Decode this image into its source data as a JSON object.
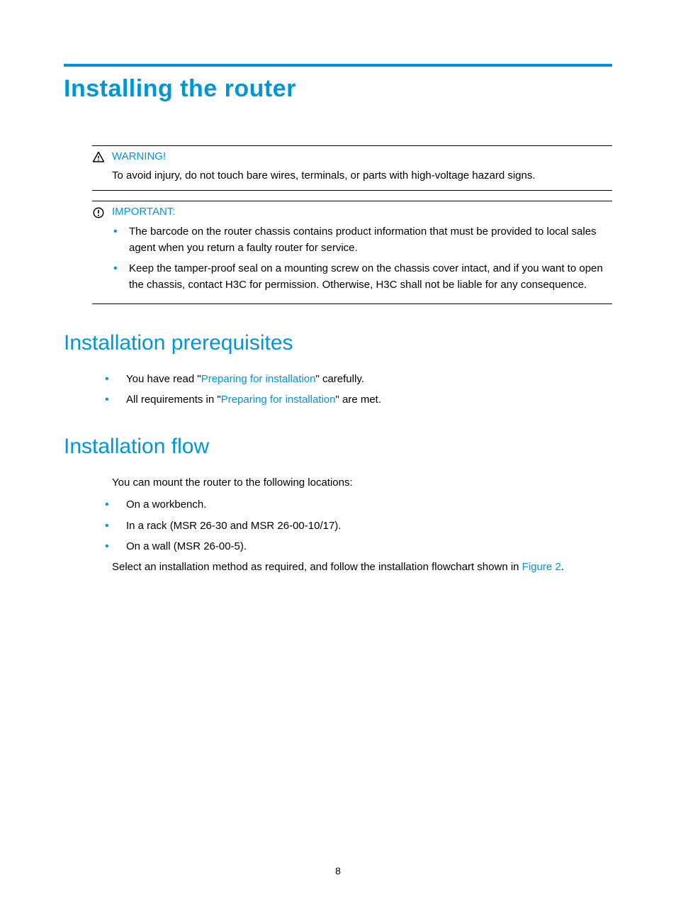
{
  "page_number": "8",
  "title": "Installing the router",
  "warning": {
    "label": "WARNING!",
    "text": "To avoid injury, do not touch bare wires, terminals, or parts with high-voltage hazard signs."
  },
  "important": {
    "label": "IMPORTANT:",
    "items": [
      "The barcode on the router chassis contains product information that must be provided to local sales agent when you return a faulty router for service.",
      "Keep the tamper-proof seal on a mounting screw on the chassis cover intact, and if you want to open the chassis, contact H3C for permission. Otherwise, H3C shall not be liable for any consequence."
    ]
  },
  "sections": {
    "prereq": {
      "heading": "Installation prerequisites",
      "items": [
        {
          "pre": "You have read \"",
          "link": "Preparing for installation",
          "post": "\" carefully."
        },
        {
          "pre": "All requirements in \"",
          "link": "Preparing for installation",
          "post": "\" are met."
        }
      ]
    },
    "flow": {
      "heading": "Installation flow",
      "intro": "You can mount the router to the following locations:",
      "items": [
        "On a workbench.",
        "In a rack (MSR 26-30 and MSR 26-00-10/17).",
        "On a wall (MSR 26-00-5)."
      ],
      "outro_pre": "Select an installation method as required, and follow the installation flowchart shown in ",
      "outro_link": "Figure 2",
      "outro_post": "."
    }
  }
}
